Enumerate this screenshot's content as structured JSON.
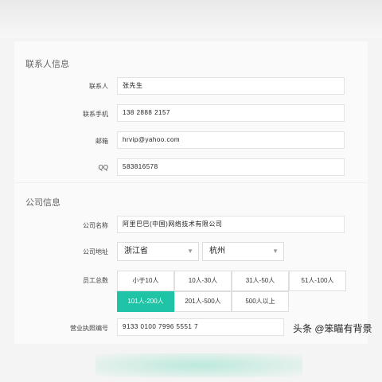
{
  "contact_section": {
    "title": "联系人信息",
    "fields": [
      {
        "label": "联系人",
        "value": "张先生"
      },
      {
        "label": "联系手机",
        "value": "138 2888 2157"
      },
      {
        "label": "邮箱",
        "value": "hrvip@yahoo.com"
      },
      {
        "label": "QQ",
        "value": "583816578"
      }
    ]
  },
  "company_section": {
    "title": "公司信息",
    "name_label": "公司名称",
    "name_value": "阿里巴巴(中国)网络技术有限公司",
    "address_label": "公司地址",
    "province_value": "浙江省",
    "city_value": "杭州",
    "staff_label": "员工总数",
    "staff_options": [
      "小于10人",
      "10人-30人",
      "31人-50人",
      "51人-100人",
      "101人-200人",
      "201人-500人",
      "500人以上"
    ],
    "staff_selected": "101人-200人",
    "license_label": "营业执照编号",
    "license_value": "9133 0100 7996 5551 7"
  },
  "watermark": "头条 @笨瞄有背景",
  "colors": {
    "accent": "#1fc3a5",
    "background": "#f4f4f4",
    "card": "#fafafa"
  }
}
